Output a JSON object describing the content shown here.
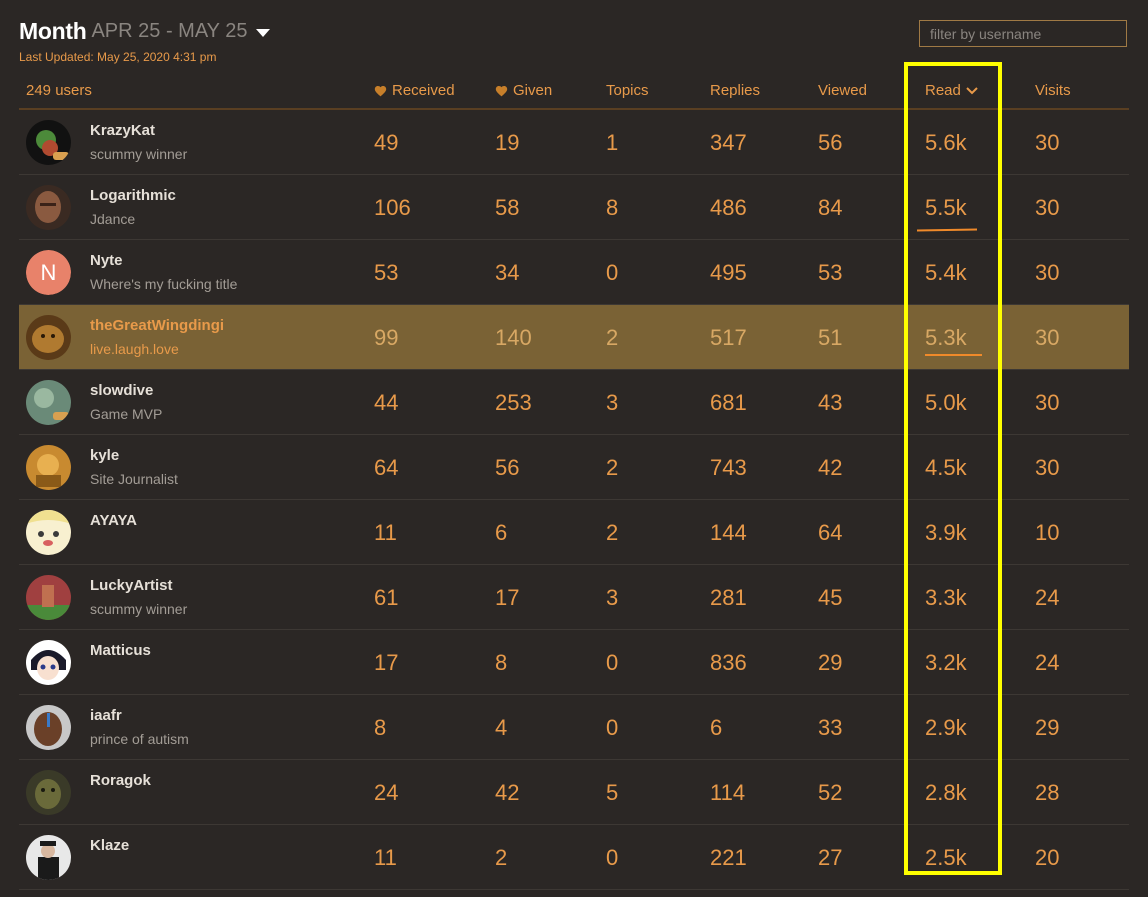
{
  "header": {
    "period_label": "Month",
    "period_range": "APR 25 - MAY 25",
    "last_updated": "Last Updated: May 25, 2020 4:31 pm"
  },
  "filter": {
    "placeholder": "filter by username"
  },
  "table": {
    "user_count": "249 users",
    "columns": {
      "received": "Received",
      "given": "Given",
      "topics": "Topics",
      "replies": "Replies",
      "viewed": "Viewed",
      "read": "Read",
      "visits": "Visits"
    },
    "rows": [
      {
        "username": "KrazyKat",
        "title": "scummy winner",
        "received": "49",
        "given": "19",
        "topics": "1",
        "replies": "347",
        "viewed": "56",
        "read": "5.6k",
        "visits": "30"
      },
      {
        "username": "Logarithmic",
        "title": "Jdance",
        "received": "106",
        "given": "58",
        "topics": "8",
        "replies": "486",
        "viewed": "84",
        "read": "5.5k",
        "visits": "30"
      },
      {
        "username": "Nyte",
        "title": "Where's my fucking title",
        "received": "53",
        "given": "34",
        "topics": "0",
        "replies": "495",
        "viewed": "53",
        "read": "5.4k",
        "visits": "30",
        "avatar_letter": "N"
      },
      {
        "username": "theGreatWingdingi",
        "title": "live.laugh.love",
        "received": "99",
        "given": "140",
        "topics": "2",
        "replies": "517",
        "viewed": "51",
        "read": "5.3k",
        "visits": "30"
      },
      {
        "username": "slowdive",
        "title": "Game MVP",
        "received": "44",
        "given": "253",
        "topics": "3",
        "replies": "681",
        "viewed": "43",
        "read": "5.0k",
        "visits": "30"
      },
      {
        "username": "kyle",
        "title": "Site Journalist",
        "received": "64",
        "given": "56",
        "topics": "2",
        "replies": "743",
        "viewed": "42",
        "read": "4.5k",
        "visits": "30"
      },
      {
        "username": "AYAYA",
        "title": "",
        "received": "11",
        "given": "6",
        "topics": "2",
        "replies": "144",
        "viewed": "64",
        "read": "3.9k",
        "visits": "10"
      },
      {
        "username": "LuckyArtist",
        "title": "scummy winner",
        "received": "61",
        "given": "17",
        "topics": "3",
        "replies": "281",
        "viewed": "45",
        "read": "3.3k",
        "visits": "24"
      },
      {
        "username": "Matticus",
        "title": "",
        "received": "17",
        "given": "8",
        "topics": "0",
        "replies": "836",
        "viewed": "29",
        "read": "3.2k",
        "visits": "24"
      },
      {
        "username": "iaafr",
        "title": "prince of autism",
        "received": "8",
        "given": "4",
        "topics": "0",
        "replies": "6",
        "viewed": "33",
        "read": "2.9k",
        "visits": "29"
      },
      {
        "username": "Roragok",
        "title": "",
        "received": "24",
        "given": "42",
        "topics": "5",
        "replies": "114",
        "viewed": "52",
        "read": "2.8k",
        "visits": "28"
      },
      {
        "username": "Klaze",
        "title": "",
        "received": "11",
        "given": "2",
        "topics": "0",
        "replies": "221",
        "viewed": "27",
        "read": "2.5k",
        "visits": "20"
      }
    ]
  },
  "colors": {
    "background": "#2b2725",
    "accent": "#e89a4a",
    "highlight_row": "#7a6235",
    "annotation": "#ffff00"
  }
}
